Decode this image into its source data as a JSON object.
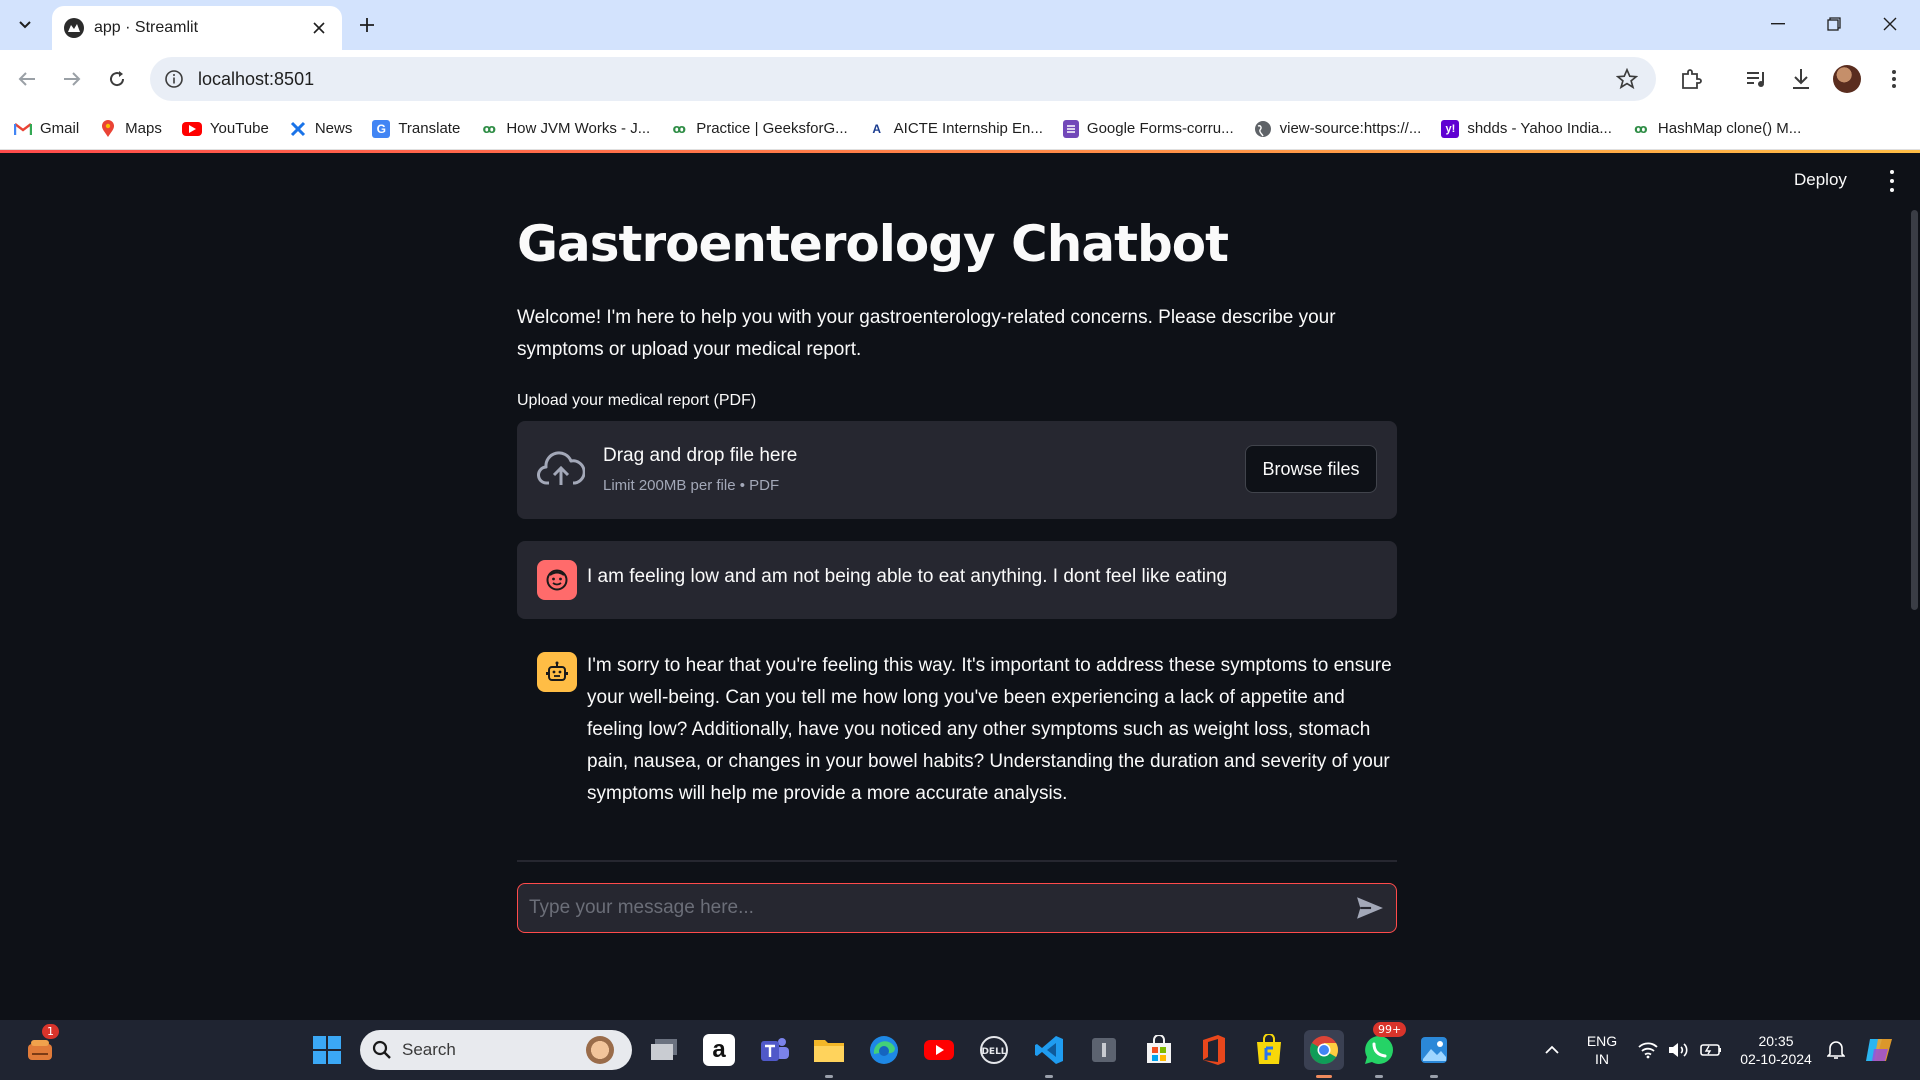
{
  "browser": {
    "tab_title": "app · Streamlit",
    "url": "localhost:8501",
    "bookmarks": [
      {
        "label": "Gmail",
        "icon": "gmail-icon"
      },
      {
        "label": "Maps",
        "icon": "maps-icon"
      },
      {
        "label": "YouTube",
        "icon": "youtube-icon"
      },
      {
        "label": "News",
        "icon": "news-icon"
      },
      {
        "label": "Translate",
        "icon": "translate-icon"
      },
      {
        "label": "How JVM Works - J...",
        "icon": "geeksforgeeks-icon"
      },
      {
        "label": "Practice | GeeksforG...",
        "icon": "geeksforgeeks-icon"
      },
      {
        "label": "AICTE Internship En...",
        "icon": "aicte-icon"
      },
      {
        "label": "Google Forms-corru...",
        "icon": "google-forms-icon"
      },
      {
        "label": "view-source:https://...",
        "icon": "globe-icon"
      },
      {
        "label": "shdds - Yahoo India...",
        "icon": "yahoo-icon"
      },
      {
        "label": "HashMap clone() M...",
        "icon": "geeksforgeeks-icon"
      }
    ]
  },
  "app": {
    "deploy_label": "Deploy",
    "title": "Gastroenterology Chatbot",
    "welcome": "Welcome! I'm here to help you with your gastroenterology-related concerns. Please describe your symptoms or upload your medical report.",
    "uploader": {
      "label": "Upload your medical report (PDF)",
      "drag_text": "Drag and drop file here",
      "limit_text": "Limit 200MB per file • PDF",
      "browse_label": "Browse files"
    },
    "messages": [
      {
        "role": "user",
        "avatar": "user-face-icon",
        "text": "I am feeling low and am not being able to eat anything. I dont feel like eating"
      },
      {
        "role": "assistant",
        "avatar": "robot-icon",
        "text": "I'm sorry to hear that you're feeling this way. It's important to address these symptoms to ensure your well-being. Can you tell me how long you've been experiencing a lack of appetite and feeling low? Additionally, have you noticed any other symptoms such as weight loss, stomach pain, nausea, or changes in your bowel habits? Understanding the duration and severity of your symptoms will help me provide a more accurate analysis."
      }
    ],
    "chat_input": {
      "placeholder": "Type your message here...",
      "value": ""
    },
    "colors": {
      "background": "#0e1117",
      "surface": "#262730",
      "accent": "#ff4b4b",
      "user_avatar": "#ff6b6b",
      "bot_avatar": "#ffbd45"
    }
  },
  "taskbar": {
    "search_placeholder": "Search",
    "widget_badge": "1",
    "whatsapp_badge": "99+",
    "language": "ENG",
    "region": "IN",
    "time": "20:35",
    "date": "02-10-2024"
  }
}
